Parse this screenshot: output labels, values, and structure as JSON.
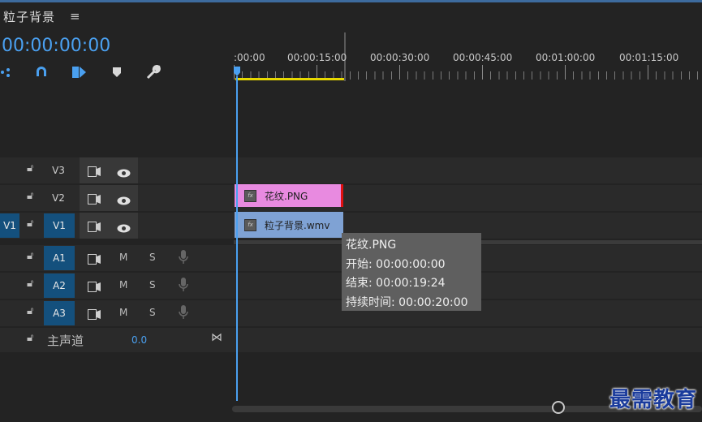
{
  "header": {
    "sequence_title": "粒子背景",
    "menu_icon": "hamburger-menu-icon"
  },
  "timecode": "00:00:00:00",
  "tools": [
    {
      "name": "snap-icon",
      "glyph": "⁂"
    },
    {
      "name": "magnet-icon",
      "glyph": "∩"
    },
    {
      "name": "linked-selection-icon",
      "glyph": "⧉"
    },
    {
      "name": "marker-icon",
      "glyph": "◆"
    },
    {
      "name": "wrench-icon",
      "glyph": "🔧"
    }
  ],
  "ruler": {
    "labels": [
      ":00:00",
      "00:00:15:00",
      "00:00:30:00",
      "00:00:45:00",
      "00:01:00:00",
      "00:01:15:00"
    ]
  },
  "video_tracks": [
    {
      "id": "V3",
      "label": "V3",
      "target": ""
    },
    {
      "id": "V2",
      "label": "V2",
      "target": ""
    },
    {
      "id": "V1",
      "label": "V1",
      "target": "V1"
    }
  ],
  "audio_tracks": [
    {
      "id": "A1",
      "label": "A1",
      "m": "M",
      "s": "S"
    },
    {
      "id": "A2",
      "label": "A2",
      "m": "M",
      "s": "S"
    },
    {
      "id": "A3",
      "label": "A3",
      "m": "M",
      "s": "S"
    }
  ],
  "master": {
    "label": "主声道",
    "value": "0.0"
  },
  "clips": [
    {
      "track": "V2",
      "name": "花纹.PNG",
      "color": "#e88ae0"
    },
    {
      "track": "V1",
      "name": "粒子背景.wmv",
      "color": "#7fa2d4"
    }
  ],
  "tooltip": {
    "name": "花纹.PNG",
    "start": "开始: 00:00:00:00",
    "end": "结束: 00:00:19:24",
    "duration": "持续时间: 00:00:20:00"
  },
  "watermark": "最需教育",
  "colors": {
    "accent": "#4aa0f0",
    "track_target": "#14507d",
    "work_area": "#e6d800"
  }
}
